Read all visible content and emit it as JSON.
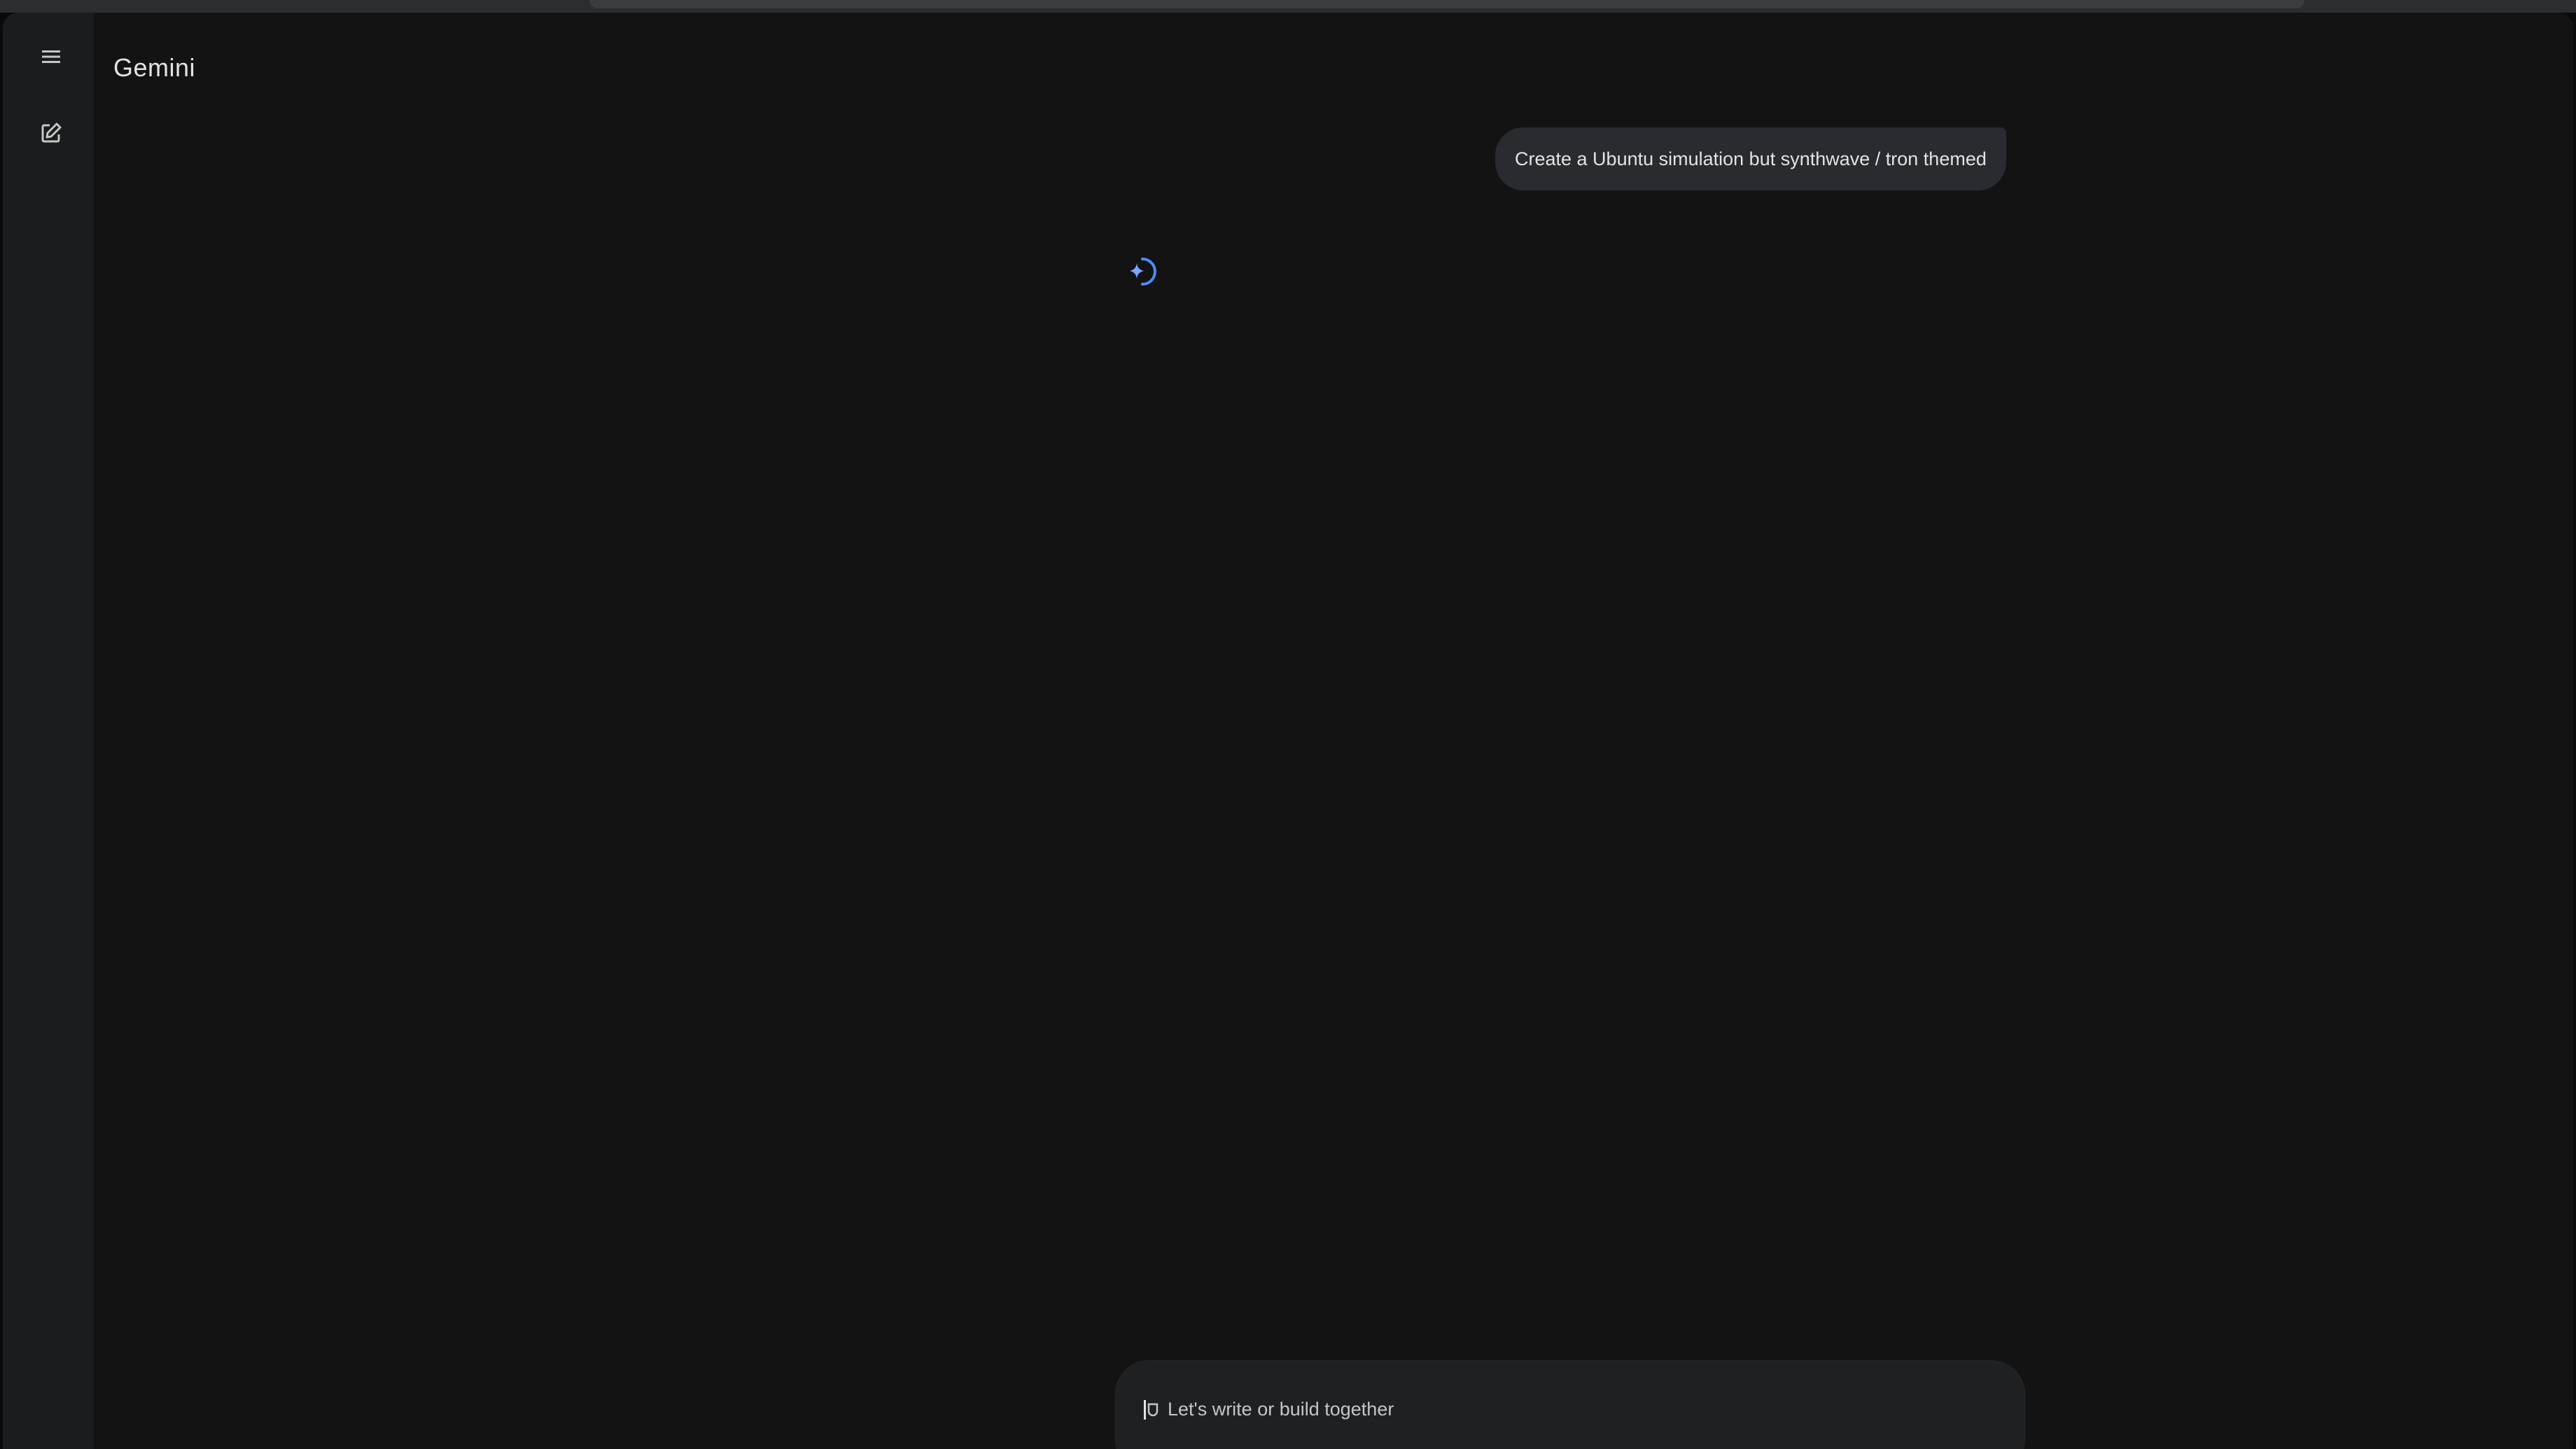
{
  "app": {
    "title": "Gemini"
  },
  "sidebar": {
    "menu_icon": "hamburger-menu-icon",
    "new_chat_icon": "edit-pencil-icon"
  },
  "conversation": {
    "user_message": "Create a Ubuntu simulation but synthwave / tron themed",
    "response_state_icon": "gemini-sparkle-loading-icon"
  },
  "input": {
    "placeholder": "Let's write or build together"
  },
  "colors": {
    "background": "#131314",
    "sidebar": "#1b1c1d",
    "bubble": "#2a2b2e",
    "accent": "#4c8df6"
  }
}
